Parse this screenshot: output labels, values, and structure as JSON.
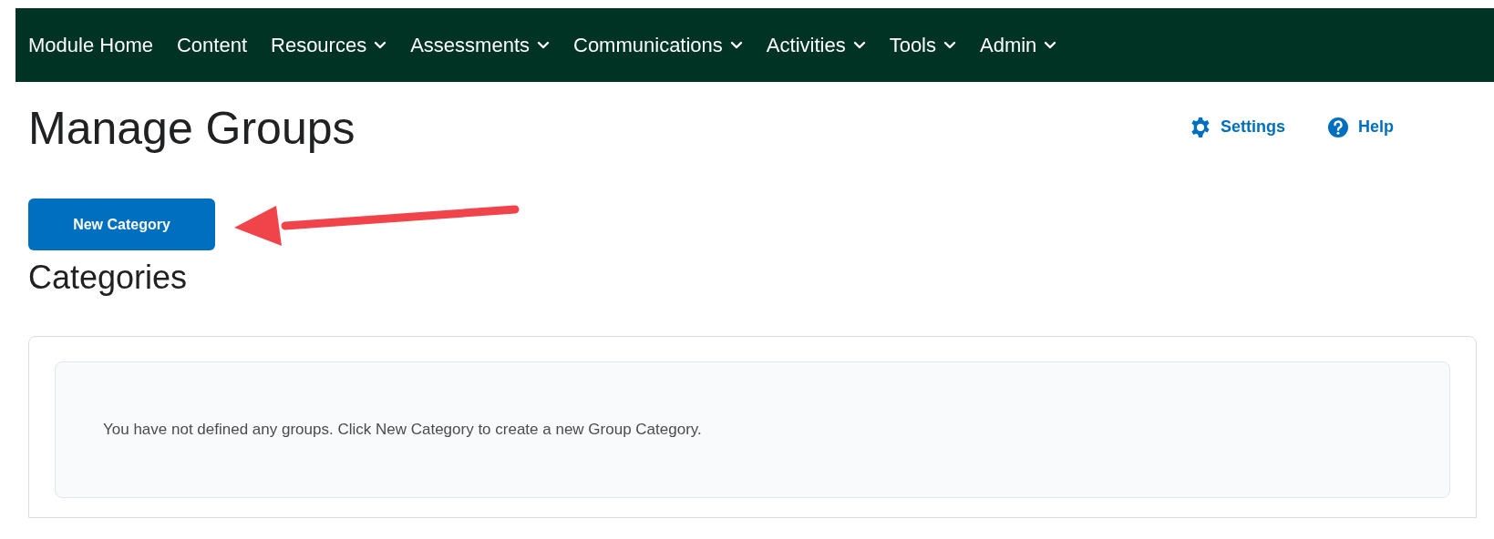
{
  "nav": [
    {
      "label": "Module Home",
      "has_menu": false
    },
    {
      "label": "Content",
      "has_menu": false
    },
    {
      "label": "Resources",
      "has_menu": true
    },
    {
      "label": "Assessments",
      "has_menu": true
    },
    {
      "label": "Communications",
      "has_menu": true
    },
    {
      "label": "Activities",
      "has_menu": true
    },
    {
      "label": "Tools",
      "has_menu": true
    },
    {
      "label": "Admin",
      "has_menu": true
    }
  ],
  "page_title": "Manage Groups",
  "header_links": [
    {
      "kind": "settings",
      "label": "Settings"
    },
    {
      "kind": "help",
      "label": "Help"
    }
  ],
  "new_button": "New Category",
  "section_title": "Categories",
  "empty_message": "You have not defined any groups. Click New Category to create a new Group Category."
}
